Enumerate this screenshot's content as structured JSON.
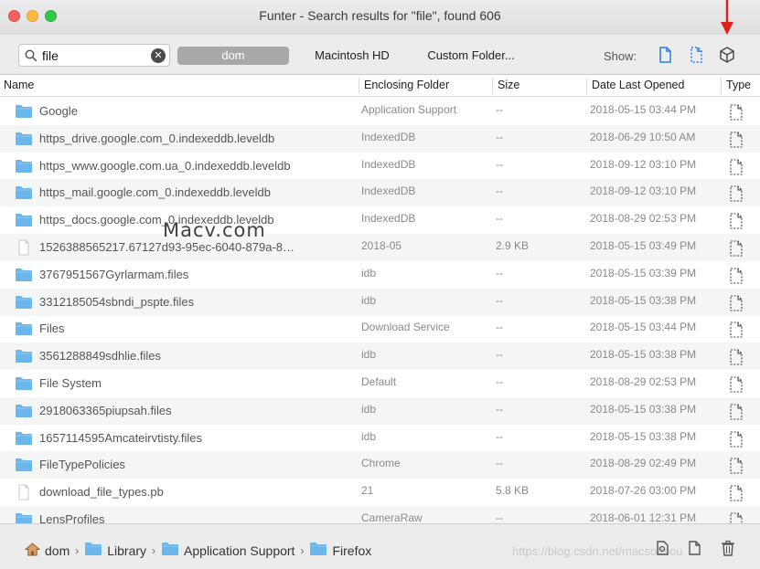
{
  "window": {
    "title": "Funter - Search results for \"file\", found 606"
  },
  "toolbar": {
    "search_value": "file",
    "scope_user": "dom",
    "scope_disk": "Macintosh HD",
    "scope_custom": "Custom Folder...",
    "show_label": "Show:"
  },
  "columns": {
    "name": "Name",
    "folder": "Enclosing Folder",
    "size": "Size",
    "date": "Date Last Opened",
    "type": "Type"
  },
  "rows": [
    {
      "icon": "folder-icon",
      "name": "Google",
      "folder": "Application Support",
      "size": "--",
      "date": "2018-05-15 03:44 PM"
    },
    {
      "icon": "folder-icon",
      "name": "https_drive.google.com_0.indexeddb.leveldb",
      "folder": "IndexedDB",
      "size": "--",
      "date": "2018-06-29 10:50 AM"
    },
    {
      "icon": "folder-icon",
      "name": "https_www.google.com.ua_0.indexeddb.leveldb",
      "folder": "IndexedDB",
      "size": "--",
      "date": "2018-09-12 03:10 PM"
    },
    {
      "icon": "folder-icon",
      "name": "https_mail.google.com_0.indexeddb.leveldb",
      "folder": "IndexedDB",
      "size": "--",
      "date": "2018-09-12 03:10 PM"
    },
    {
      "icon": "folder-icon",
      "name": "https_docs.google.com_0.indexeddb.leveldb",
      "folder": "IndexedDB",
      "size": "--",
      "date": "2018-08-29 02:53 PM"
    },
    {
      "icon": "file-icon",
      "name": "1526388565217.67127d93-95ec-6040-879a-8…",
      "folder": "2018-05",
      "size": "2.9 KB",
      "date": "2018-05-15 03:49 PM"
    },
    {
      "icon": "folder-icon",
      "name": "3767951567Gyrlarmam.files",
      "folder": "idb",
      "size": "--",
      "date": "2018-05-15 03:39 PM"
    },
    {
      "icon": "folder-icon",
      "name": "3312185054sbndi_pspte.files",
      "folder": "idb",
      "size": "--",
      "date": "2018-05-15 03:38 PM"
    },
    {
      "icon": "folder-icon",
      "name": "Files",
      "folder": "Download Service",
      "size": "--",
      "date": "2018-05-15 03:44 PM"
    },
    {
      "icon": "folder-icon",
      "name": "3561288849sdhlie.files",
      "folder": "idb",
      "size": "--",
      "date": "2018-05-15 03:38 PM"
    },
    {
      "icon": "folder-icon",
      "name": "File System",
      "folder": "Default",
      "size": "--",
      "date": "2018-08-29 02:53 PM"
    },
    {
      "icon": "folder-icon",
      "name": "2918063365piupsah.files",
      "folder": "idb",
      "size": "--",
      "date": "2018-05-15 03:38 PM"
    },
    {
      "icon": "folder-icon",
      "name": "1657114595Amcateirvtisty.files",
      "folder": "idb",
      "size": "--",
      "date": "2018-05-15 03:38 PM"
    },
    {
      "icon": "folder-icon",
      "name": "FileTypePolicies",
      "folder": "Chrome",
      "size": "--",
      "date": "2018-08-29 02:49 PM"
    },
    {
      "icon": "file-icon",
      "name": "download_file_types.pb",
      "folder": "21",
      "size": "5.8 KB",
      "date": "2018-07-26 03:00 PM"
    },
    {
      "icon": "folder-icon",
      "name": "LensProfiles",
      "folder": "CameraRaw",
      "size": "--",
      "date": "2018-06-01 12:31 PM"
    }
  ],
  "watermark": "Macv.com",
  "breadcrumb": [
    {
      "icon": "home-icon",
      "label": "dom"
    },
    {
      "icon": "folder-icon",
      "label": "Library"
    },
    {
      "icon": "folder-icon",
      "label": "Application Support"
    },
    {
      "icon": "folder-icon",
      "label": "Firefox"
    }
  ],
  "footer_watermark": "https://blog.csdn.net/macsoftsou",
  "colors": {
    "folder": "#6bb7ec",
    "accent_arrow": "#e0201b"
  }
}
